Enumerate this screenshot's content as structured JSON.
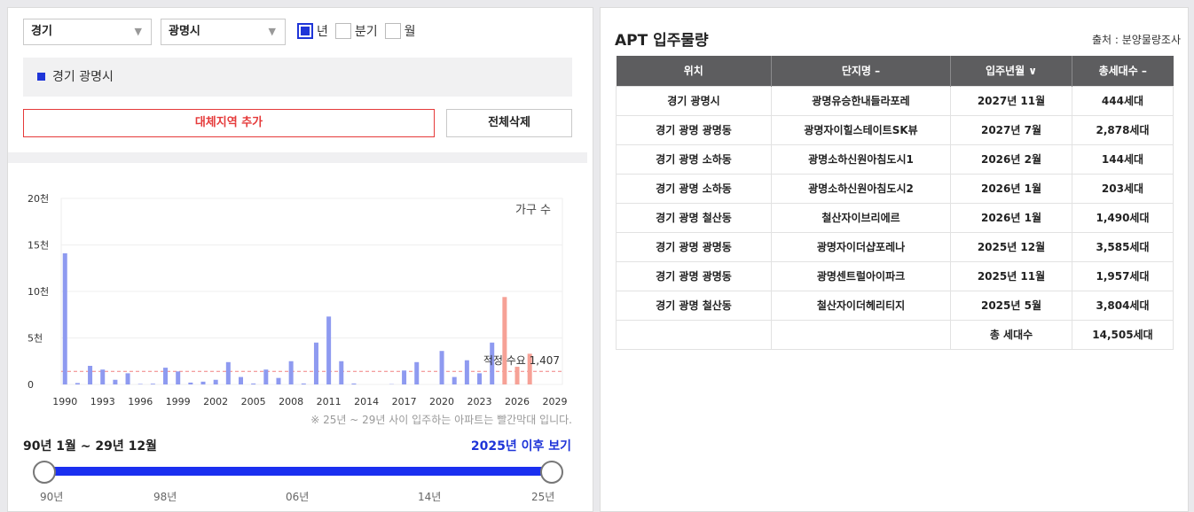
{
  "filters": {
    "province": "경기",
    "city": "광명시",
    "period_options": [
      {
        "label": "년",
        "checked": true
      },
      {
        "label": "분기",
        "checked": false
      },
      {
        "label": "월",
        "checked": false
      }
    ]
  },
  "selected_region": "경기 광명시",
  "buttons": {
    "add_region": "대체지역 추가",
    "delete_all": "전체삭제"
  },
  "chart_data": {
    "type": "bar",
    "unit_label": "가구 수",
    "y_ticks": [
      "0",
      "5천",
      "10천",
      "15천",
      "20천"
    ],
    "ylim": [
      0,
      20000
    ],
    "x_ticks": [
      "1990",
      "1993",
      "1996",
      "1999",
      "2002",
      "2005",
      "2008",
      "2011",
      "2014",
      "2017",
      "2020",
      "2023",
      "2026",
      "2029"
    ],
    "years": [
      1990,
      1991,
      1992,
      1993,
      1994,
      1995,
      1996,
      1997,
      1998,
      1999,
      2000,
      2001,
      2002,
      2003,
      2004,
      2005,
      2006,
      2007,
      2008,
      2009,
      2010,
      2011,
      2012,
      2013,
      2014,
      2015,
      2016,
      2017,
      2018,
      2019,
      2020,
      2021,
      2022,
      2023,
      2024,
      2025,
      2026,
      2027,
      2028,
      2029
    ],
    "values": [
      14100,
      150,
      2000,
      1600,
      500,
      1200,
      50,
      80,
      1800,
      1400,
      200,
      300,
      500,
      2400,
      800,
      100,
      1600,
      700,
      2500,
      100,
      4500,
      7300,
      2500,
      100,
      0,
      0,
      30,
      1500,
      2400,
      0,
      3600,
      800,
      2600,
      1200,
      4500,
      9400,
      1900,
      3300,
      0,
      0
    ],
    "forecast_from": 2025,
    "colors": {
      "past": "#8e9af0",
      "future": "#f6a196",
      "reference": "#f08080"
    },
    "reference_line": {
      "value": 1407,
      "label": "적정 수요 1,407"
    }
  },
  "footnote": "※ 25년 ~ 29년 사이 입주하는 아파트는 빨간막대 입니다.",
  "range": {
    "title": "90년 1월 ~ 29년 12월",
    "after_link": "2025년 이후 보기",
    "ticks": [
      "90년",
      "98년",
      "06년",
      "14년",
      "25년"
    ]
  },
  "table": {
    "title": "APT 입주물량",
    "source": "출처 : 분양물량조사",
    "headers": [
      "위치",
      "단지명 –",
      "입주년월 ∨",
      "총세대수 –"
    ],
    "rows": [
      [
        "경기 광명시",
        "광명유승한내들라포레",
        "2027년 11월",
        "444세대"
      ],
      [
        "경기 광명 광명동",
        "광명자이힐스테이트SK뷰",
        "2027년 7월",
        "2,878세대"
      ],
      [
        "경기 광명 소하동",
        "광명소하신원아침도시1",
        "2026년 2월",
        "144세대"
      ],
      [
        "경기 광명 소하동",
        "광명소하신원아침도시2",
        "2026년 1월",
        "203세대"
      ],
      [
        "경기 광명 철산동",
        "철산자이브리에르",
        "2026년 1월",
        "1,490세대"
      ],
      [
        "경기 광명 광명동",
        "광명자이더샵포레나",
        "2025년 12월",
        "3,585세대"
      ],
      [
        "경기 광명 광명동",
        "광명센트럴아이파크",
        "2025년 11월",
        "1,957세대"
      ],
      [
        "경기 광명 철산동",
        "철산자이더헤리티지",
        "2025년 5월",
        "3,804세대"
      ]
    ],
    "total_label": "총 세대수",
    "total_value": "14,505세대"
  }
}
